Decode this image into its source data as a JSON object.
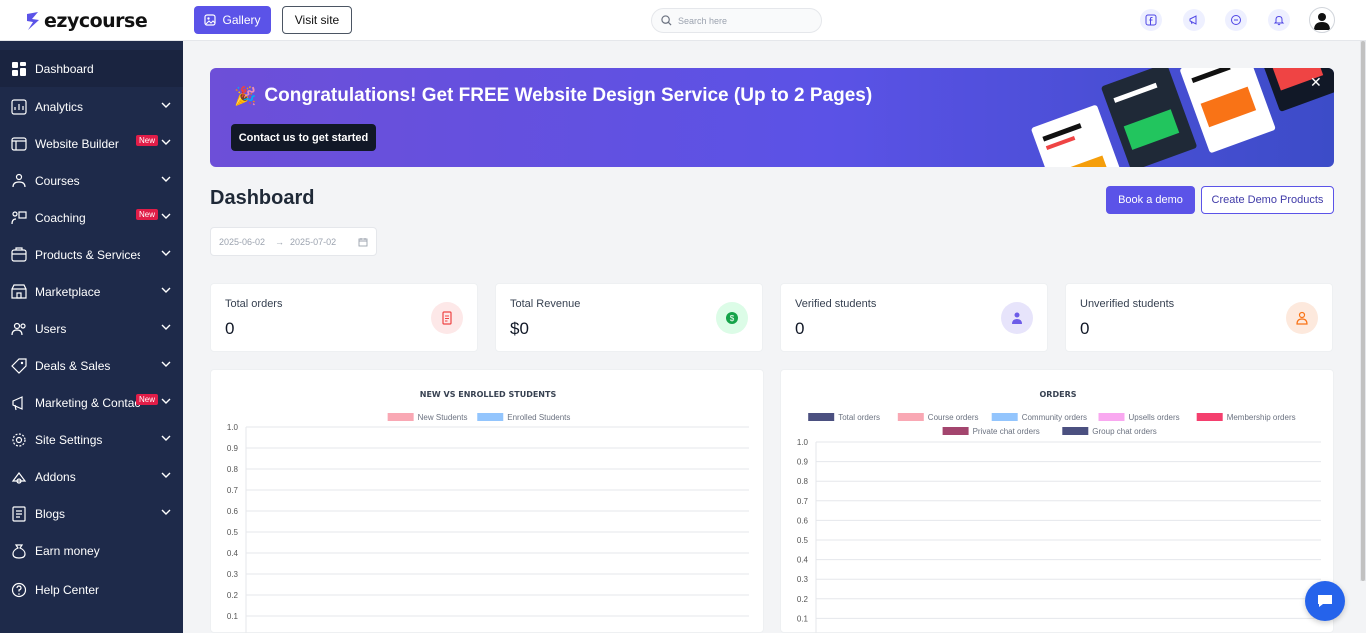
{
  "brand": {
    "name": "ezycourse",
    "accent": "#5b53e8"
  },
  "topbar": {
    "gallery_label": "Gallery",
    "visit_label": "Visit site",
    "search_placeholder": "Search here",
    "icons": [
      "facebook-icon",
      "megaphone-icon",
      "chat-bubble-icon",
      "bell-icon",
      "user-avatar-icon"
    ]
  },
  "sidebar": {
    "items": [
      {
        "label": "Dashboard",
        "icon": "dashboard-icon",
        "active": true
      },
      {
        "label": "Analytics",
        "icon": "analytics-icon",
        "chevron": true
      },
      {
        "label": "Website Builder",
        "icon": "website-builder-icon",
        "chevron": true,
        "badge": "New"
      },
      {
        "label": "Courses",
        "icon": "courses-icon",
        "chevron": true
      },
      {
        "label": "Coaching",
        "icon": "coaching-icon",
        "chevron": true,
        "badge": "New"
      },
      {
        "label": "Products & Services",
        "icon": "products-icon",
        "chevron": true
      },
      {
        "label": "Marketplace",
        "icon": "marketplace-icon",
        "chevron": true
      },
      {
        "label": "Users",
        "icon": "users-icon",
        "chevron": true
      },
      {
        "label": "Deals & Sales",
        "icon": "tag-icon",
        "chevron": true
      },
      {
        "label": "Marketing & Contacts",
        "icon": "megaphone-icon",
        "chevron": true,
        "badge": "New"
      },
      {
        "label": "Site Settings",
        "icon": "gear-icon",
        "chevron": true
      },
      {
        "label": "Addons",
        "icon": "addons-icon",
        "chevron": true
      },
      {
        "label": "Blogs",
        "icon": "blogs-icon",
        "chevron": true
      },
      {
        "label": "Earn money",
        "icon": "money-bag-icon"
      },
      {
        "label": "Help Center",
        "icon": "help-icon"
      }
    ]
  },
  "banner": {
    "title": "Congratulations! Get FREE Website Design Service (Up to 2 Pages)",
    "cta": "Contact us to get started"
  },
  "header": {
    "title": "Dashboard",
    "book_demo": "Book a demo",
    "create_demo": "Create Demo Products",
    "date_start": "2025-06-02",
    "date_end": "2025-07-02"
  },
  "stats": [
    {
      "label": "Total orders",
      "value": "0",
      "icon": "receipt-icon",
      "color": "#ef4444"
    },
    {
      "label": "Total Revenue",
      "value": "$0",
      "icon": "dollar-icon",
      "color": "#16a34a"
    },
    {
      "label": "Verified students",
      "value": "0",
      "icon": "verified-user-icon",
      "color": "#6d5ce8"
    },
    {
      "label": "Unverified students",
      "value": "0",
      "icon": "unverified-user-icon",
      "color": "#f97316"
    }
  ],
  "chart_data": [
    {
      "type": "bar",
      "title": "NEW VS ENROLLED STUDENTS",
      "series": [
        {
          "name": "New Students",
          "color": "#f9a8b4",
          "values": []
        },
        {
          "name": "Enrolled Students",
          "color": "#93c5fd",
          "values": []
        }
      ],
      "yticks": [
        "1.0",
        "0.9",
        "0.8",
        "0.7",
        "0.6",
        "0.5",
        "0.4",
        "0.3",
        "0.2",
        "0.1"
      ],
      "ylim": [
        0,
        1
      ],
      "grid": true,
      "legend": "top"
    },
    {
      "type": "bar",
      "title": "ORDERS",
      "series": [
        {
          "name": "Total orders",
          "color": "#4b5080",
          "values": []
        },
        {
          "name": "Course orders",
          "color": "#f9a8b4",
          "values": []
        },
        {
          "name": "Community orders",
          "color": "#93c5fd",
          "values": []
        },
        {
          "name": "Upsells orders",
          "color": "#f9a8f0",
          "values": []
        },
        {
          "name": "Membership orders",
          "color": "#f43f6e",
          "values": []
        },
        {
          "name": "Private chat orders",
          "color": "#a3456e",
          "values": []
        },
        {
          "name": "Group chat orders",
          "color": "#4b5080",
          "values": []
        }
      ],
      "yticks": [
        "1.0",
        "0.9",
        "0.8",
        "0.7",
        "0.6",
        "0.5",
        "0.4",
        "0.3",
        "0.2",
        "0.1"
      ],
      "ylim": [
        0,
        1
      ],
      "grid": true,
      "legend": "top"
    }
  ]
}
